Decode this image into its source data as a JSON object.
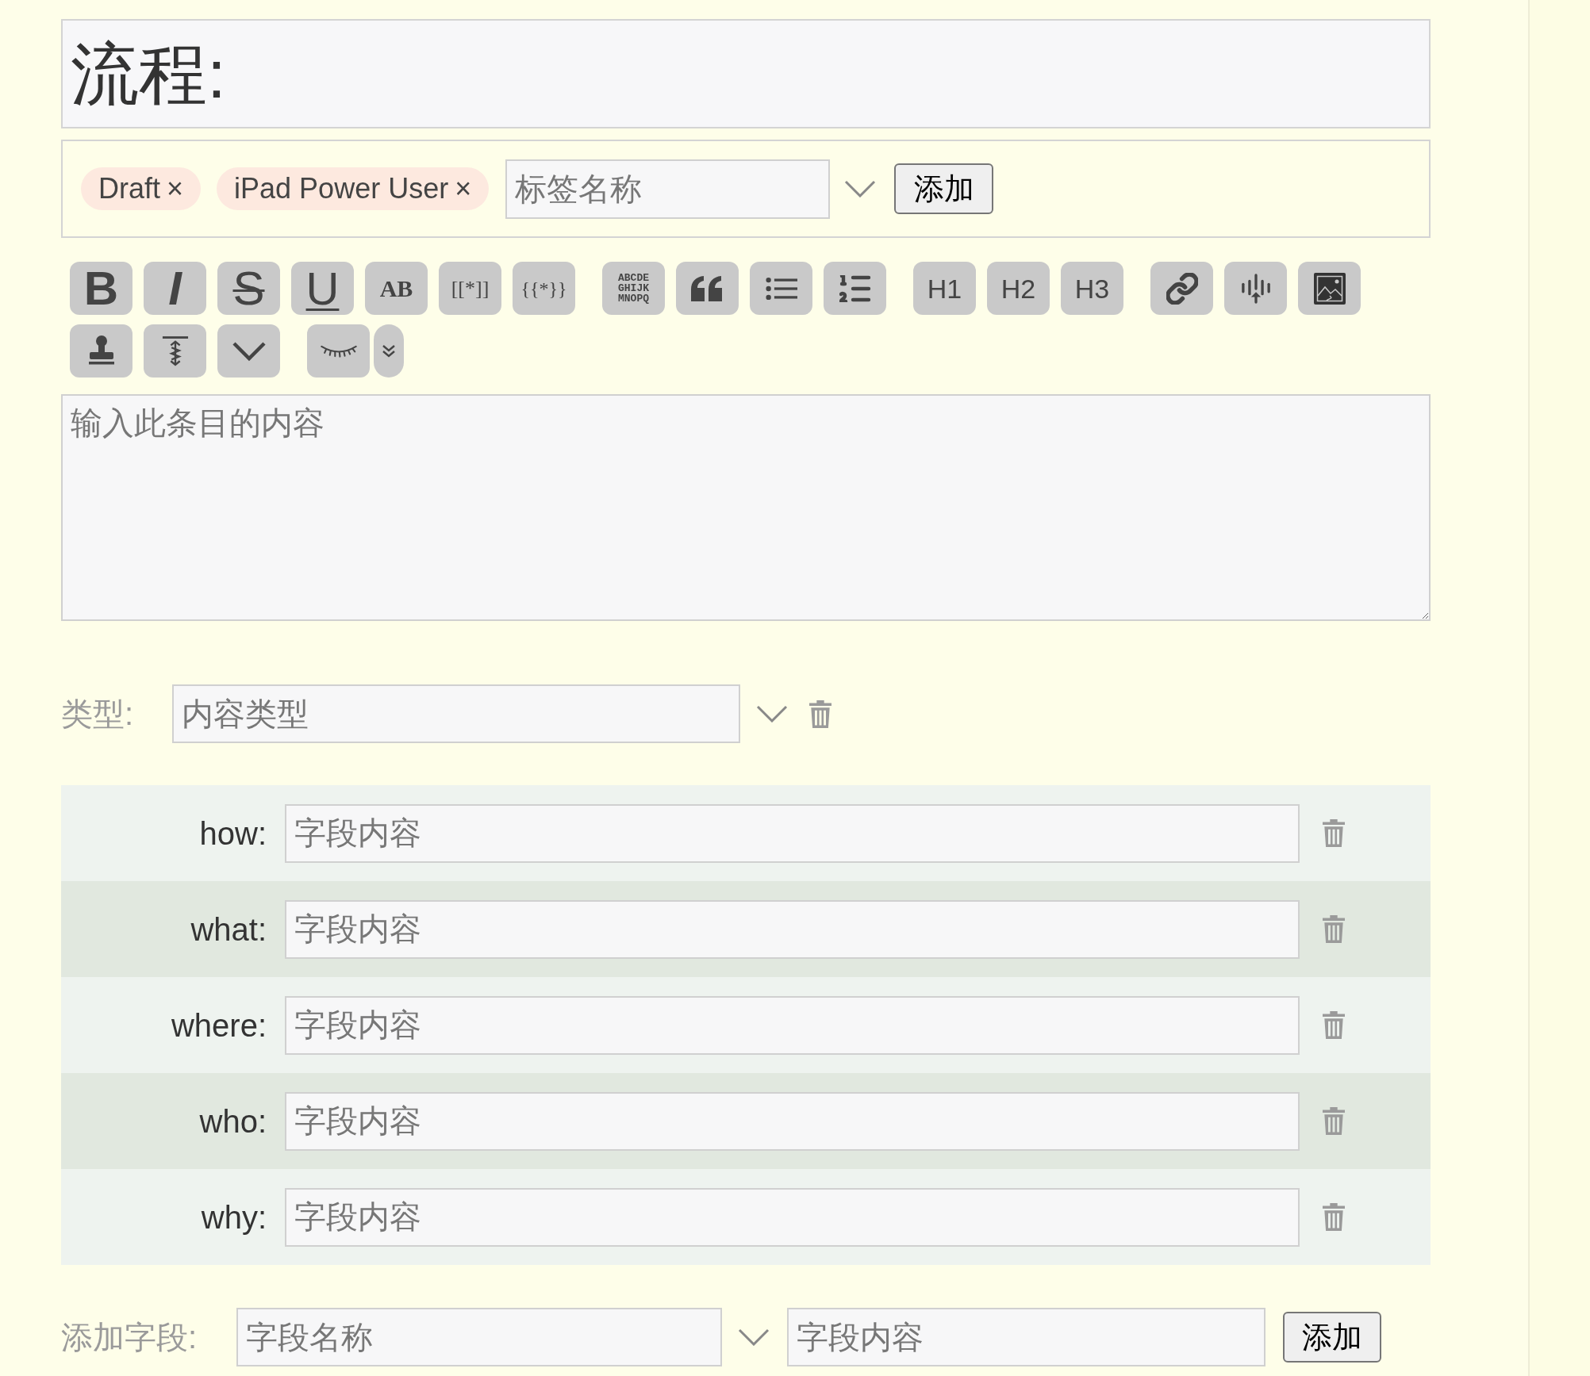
{
  "title": {
    "value": "流程:"
  },
  "tags": {
    "items": [
      {
        "label": "Draft",
        "remove": "×"
      },
      {
        "label": "iPad Power User",
        "remove": "×"
      }
    ],
    "input": {
      "placeholder": "标签名称"
    },
    "button": "添加"
  },
  "toolbar": [
    [
      [
        {
          "kind": "bold",
          "label": "B"
        },
        {
          "kind": "italic",
          "label": "I"
        },
        {
          "kind": "strike",
          "label": "S"
        },
        {
          "kind": "underline",
          "label": "U"
        },
        {
          "kind": "serif-bold",
          "label": "AB"
        },
        {
          "kind": "brackets",
          "label": "[[*]]"
        },
        {
          "kind": "braces",
          "label": "{{*}}"
        }
      ],
      [
        {
          "kind": "mono-lines",
          "lines": [
            "ABCDE",
            "GHIJK",
            "MNOPQ"
          ]
        },
        {
          "kind": "quote"
        },
        {
          "kind": "bullet-list"
        },
        {
          "kind": "numbered-list"
        }
      ],
      [
        {
          "kind": "heading",
          "label": "H1"
        },
        {
          "kind": "heading",
          "label": "H2"
        },
        {
          "kind": "heading",
          "label": "H3"
        }
      ],
      [
        {
          "kind": "link"
        },
        {
          "kind": "audio"
        },
        {
          "kind": "image"
        }
      ]
    ],
    [
      [
        {
          "kind": "stamp"
        },
        {
          "kind": "spacing"
        },
        {
          "kind": "chevron"
        }
      ],
      [
        {
          "kind": "eye-closed"
        },
        {
          "kind": "more"
        }
      ]
    ]
  ],
  "content": {
    "placeholder": "输入此条目的内容"
  },
  "type": {
    "label": "类型:",
    "placeholder": "内容类型"
  },
  "fields": [
    {
      "label": "how:",
      "placeholder": "字段内容"
    },
    {
      "label": "what:",
      "placeholder": "字段内容"
    },
    {
      "label": "where:",
      "placeholder": "字段内容"
    },
    {
      "label": "who:",
      "placeholder": "字段内容"
    },
    {
      "label": "why:",
      "placeholder": "字段内容"
    }
  ],
  "add_field": {
    "label": "添加字段:",
    "name_placeholder": "字段名称",
    "value_placeholder": "字段内容",
    "button": "添加"
  }
}
